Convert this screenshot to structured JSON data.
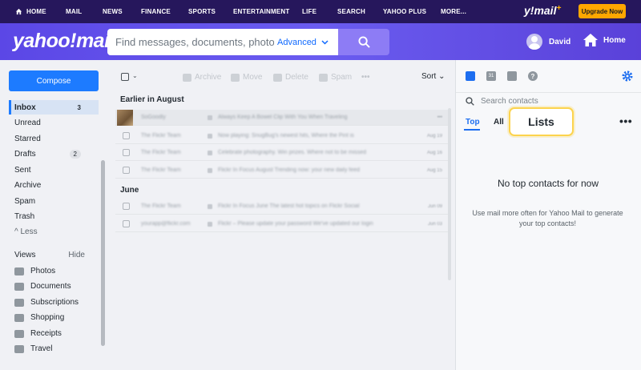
{
  "topnav": {
    "items": [
      "HOME",
      "MAIL",
      "NEWS",
      "FINANCE",
      "SPORTS",
      "ENTERTAINMENT",
      "LIFE",
      "SEARCH",
      "YAHOO PLUS",
      "MORE..."
    ],
    "brand": "y!mail",
    "upgrade_label": "Upgrade Now"
  },
  "header": {
    "logo": "yahoo!mail",
    "search_placeholder": "Find messages, documents, photos or peo|",
    "advanced_label": "Advanced",
    "user_name": "David",
    "home_label": "Home"
  },
  "sidebar": {
    "compose_label": "Compose",
    "folders": [
      {
        "label": "Inbox",
        "count": "3"
      },
      {
        "label": "Unread",
        "count": ""
      },
      {
        "label": "Starred",
        "count": ""
      },
      {
        "label": "Drafts",
        "count": "2"
      },
      {
        "label": "Sent",
        "count": ""
      },
      {
        "label": "Archive",
        "count": ""
      },
      {
        "label": "Spam",
        "count": ""
      },
      {
        "label": "Trash",
        "count": ""
      }
    ],
    "less_label": "^ Less",
    "views_label": "Views",
    "hide_label": "Hide",
    "views": [
      {
        "label": "Photos",
        "icon": "photos-icon"
      },
      {
        "label": "Documents",
        "icon": "documents-icon"
      },
      {
        "label": "Subscriptions",
        "icon": "subscriptions-icon"
      },
      {
        "label": "Shopping",
        "icon": "shopping-icon"
      },
      {
        "label": "Receipts",
        "icon": "receipts-icon"
      },
      {
        "label": "Travel",
        "icon": "travel-icon"
      }
    ]
  },
  "toolbar": {
    "archive_label": "Archive",
    "move_label": "Move",
    "delete_label": "Delete",
    "spam_label": "Spam",
    "more_label": "•••",
    "sort_label": "Sort"
  },
  "messages": {
    "section_august": "Earlier in August",
    "section_june": "June",
    "august": [
      {
        "sender": "SoGoodly",
        "subject": "Always Keep A Bowel Clip With You When Traveling",
        "date": "•••"
      },
      {
        "sender": "The Flickr Team",
        "subject": "Now playing: SnugBug's newest hits, Where the Pint is",
        "date": "Aug 19"
      },
      {
        "sender": "The Flickr Team",
        "subject": "Celebrate photography. Win prizes. Where not to be missed",
        "date": "Aug 16"
      },
      {
        "sender": "The Flickr Team",
        "subject": "Flickr In Focus August   Trending now: your new daily feed",
        "date": "Aug 15"
      }
    ],
    "june": [
      {
        "sender": "The Flickr Team",
        "subject": "Flickr In Focus June   The latest hot topics on Flickr Social",
        "date": "Jun 09"
      },
      {
        "sender": "yourapp@flickr.com",
        "subject": "Flickr – Please update your password   We've updated our login",
        "date": "Jun 03"
      }
    ]
  },
  "rpanel": {
    "search_placeholder": "Search contacts",
    "tab_top": "Top",
    "tab_all": "All",
    "tab_lists": "Lists",
    "more_label": "•••",
    "empty_title": "No top contacts for now",
    "empty_text": "Use mail more often for Yahoo Mail to generate your top contacts!"
  }
}
